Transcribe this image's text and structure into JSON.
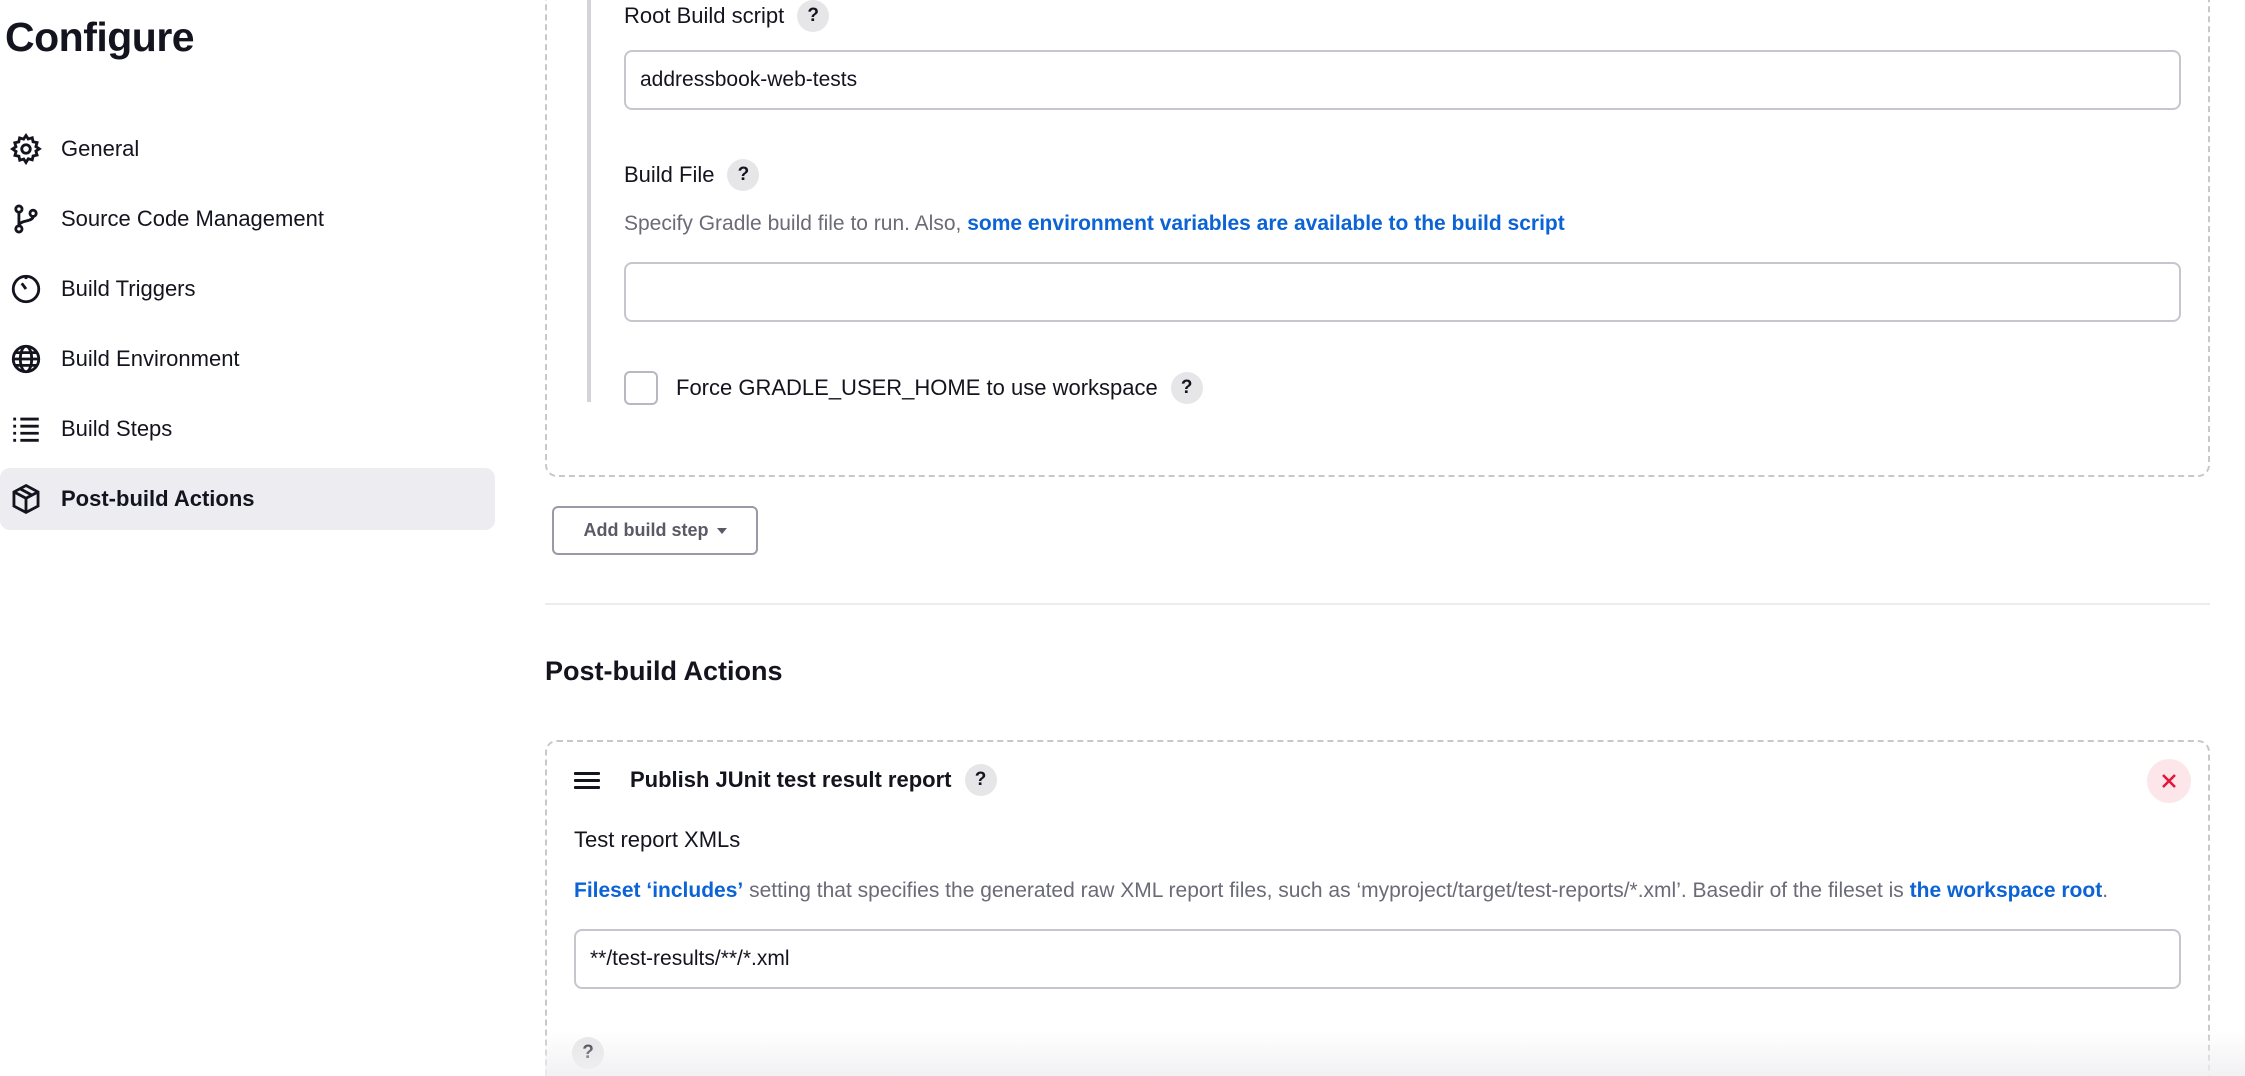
{
  "page": {
    "title": "Configure"
  },
  "sidebar": {
    "items": [
      {
        "label": "General",
        "icon": "gear-icon",
        "active": false
      },
      {
        "label": "Source Code Management",
        "icon": "git-branch-icon",
        "active": false
      },
      {
        "label": "Build Triggers",
        "icon": "timer-icon",
        "active": false
      },
      {
        "label": "Build Environment",
        "icon": "globe-icon",
        "active": false
      },
      {
        "label": "Build Steps",
        "icon": "list-icon",
        "active": false
      },
      {
        "label": "Post-build Actions",
        "icon": "package-icon",
        "active": true
      }
    ]
  },
  "gradle": {
    "root_build_script_label": "Root Build script",
    "root_build_script_value": "addressbook-web-tests",
    "build_file_label": "Build File",
    "build_file_desc_prefix": "Specify Gradle build file to run. Also, ",
    "build_file_desc_link": "some environment variables are available to the build script",
    "build_file_value": "",
    "force_home_label": "Force GRADLE_USER_HOME to use workspace",
    "force_home_checked": false,
    "help_label": "?"
  },
  "add_build_step": {
    "label": "Add build step"
  },
  "post_build": {
    "section_title": "Post-build Actions",
    "step_title": "Publish JUnit test result report",
    "test_report_label": "Test report XMLs",
    "desc_link1": "Fileset ‘includes’",
    "desc_middle": " setting that specifies the generated raw XML report files, such as ‘myproject/target/test-reports/*.xml’. Basedir of the fileset is ",
    "desc_link2": "the workspace root",
    "desc_end": ".",
    "test_report_value": "**/test-results/**/*.xml"
  },
  "colors": {
    "link": "#0b63d6",
    "active_bg": "#ececf1",
    "close_red": "#e4163a"
  }
}
